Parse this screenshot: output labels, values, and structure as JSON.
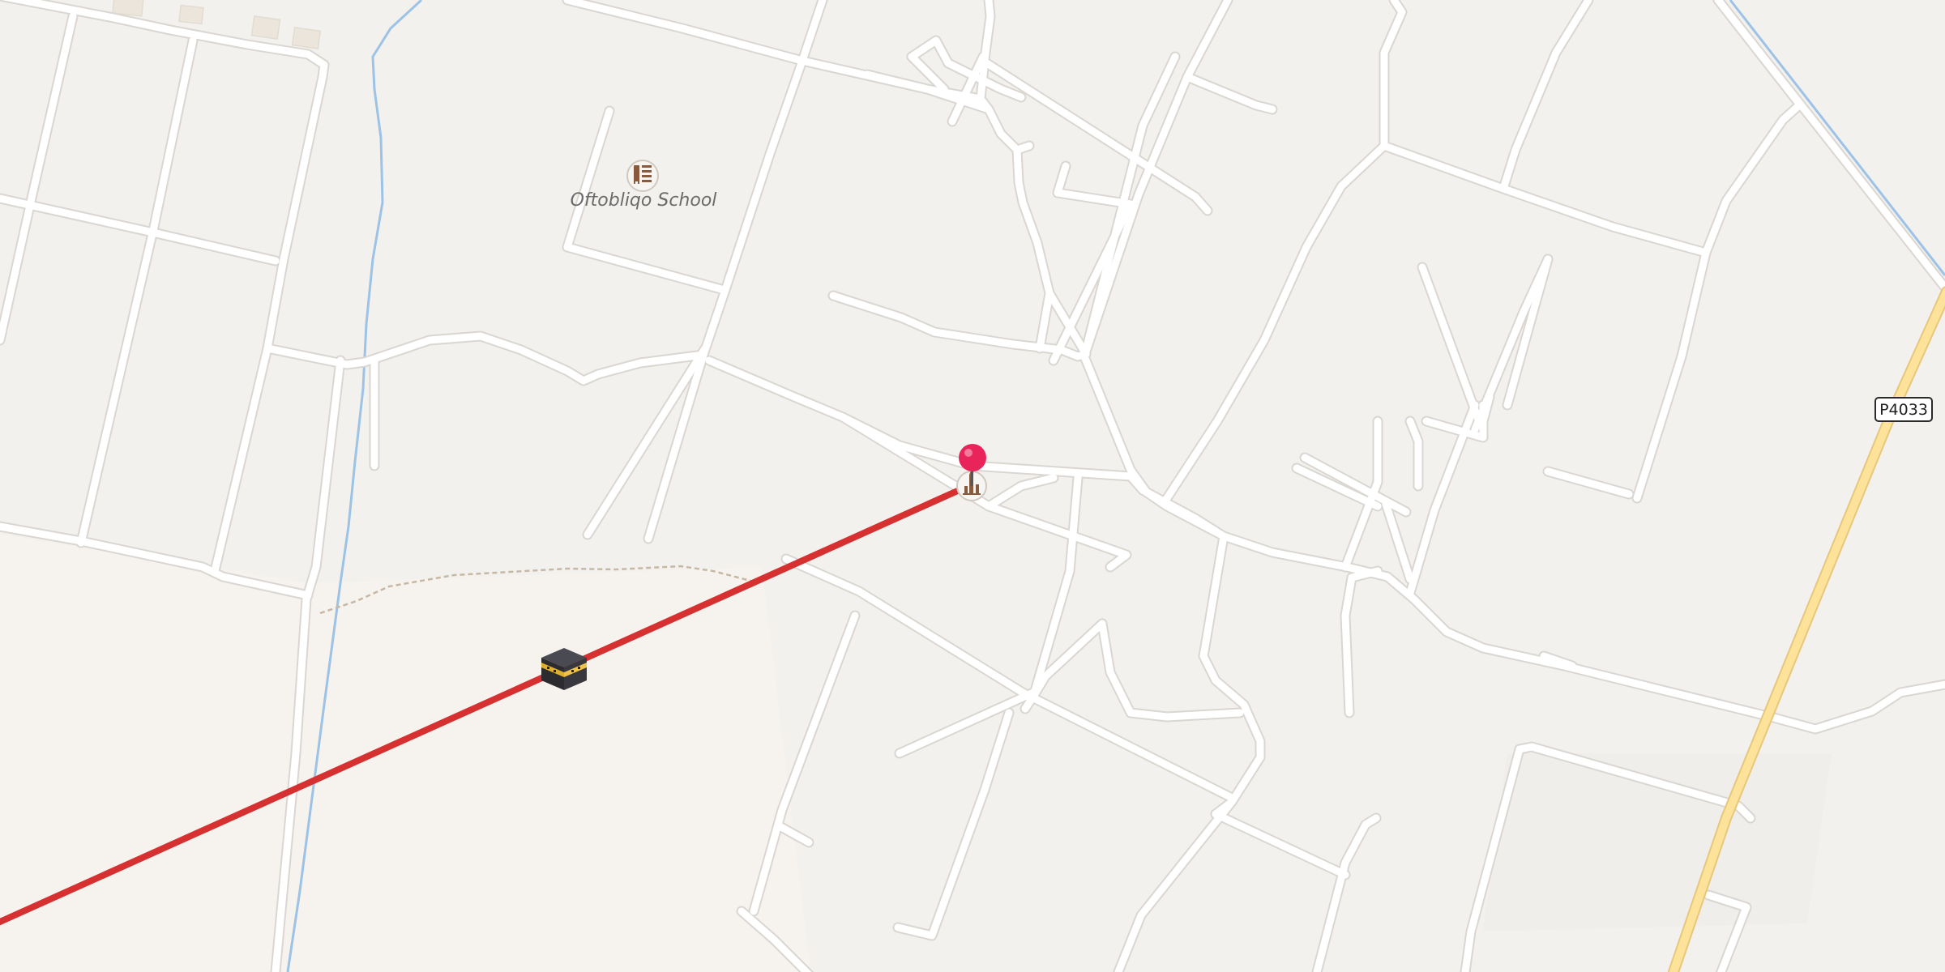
{
  "map": {
    "pois": [
      {
        "name": "Oftobliqo School",
        "icon": "school-icon"
      }
    ],
    "road_shield": {
      "ref": "Р4033"
    },
    "markers": {
      "selected_pin": {
        "icon": "location-pin-icon",
        "color": "#e8245a"
      },
      "mosque": {
        "icon": "mosque-icon"
      },
      "kaaba": {
        "icon": "kaaba-icon"
      }
    },
    "qibla_line": {
      "color": "#d63031"
    },
    "colors": {
      "background": "#f3f1ee",
      "road_fill": "#ffffff",
      "road_casing": "#dad6d1",
      "main_road": "#fde29a",
      "main_road_casing": "#e7c77b",
      "waterway": "#9cc3e6",
      "path": "#c7b8a5",
      "building": "#ede7df"
    }
  }
}
